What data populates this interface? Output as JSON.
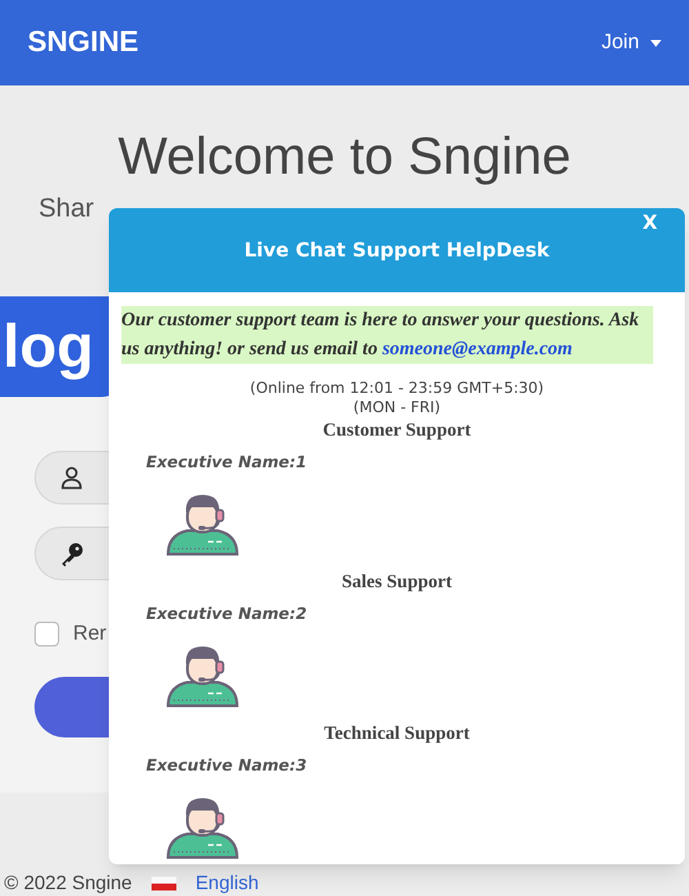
{
  "header": {
    "logo": "SNGINE",
    "join": "Join"
  },
  "hero": {
    "title": "Welcome to Sngine",
    "subtitle": "Shar"
  },
  "login": {
    "logo_fragment": "log",
    "remember": {
      "label": "Rer",
      "checked": false
    }
  },
  "modal": {
    "close": "X",
    "title": "Live Chat Support HelpDesk",
    "intro": "Our customer support team is here to answer your questions. Ask us anything! or send us email to",
    "email": "someone@example.com",
    "hours": "(Online from 12:01 - 23:59 GMT+5:30)",
    "days": "(MON - FRI)",
    "teams": [
      {
        "name": "Customer Support",
        "executive": "Executive Name:1"
      },
      {
        "name": "Sales Support",
        "executive": "Executive Name:2"
      },
      {
        "name": "Technical Support",
        "executive": "Executive Name:3"
      }
    ]
  },
  "footer": {
    "copyright": "© 2022 Sngine",
    "language": "English"
  }
}
